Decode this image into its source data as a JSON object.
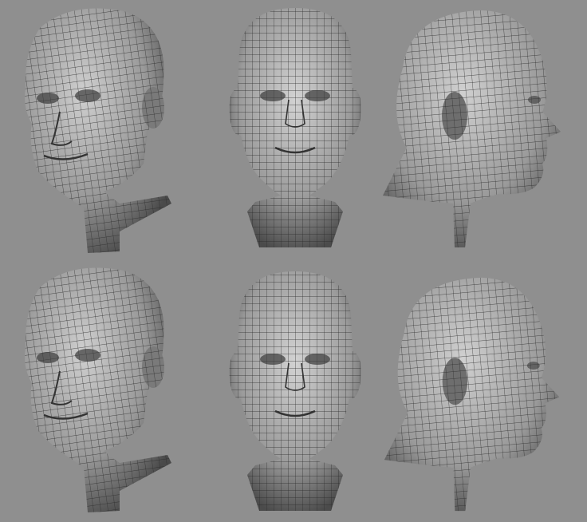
{
  "scene": {
    "background": "#8f8f8f",
    "mesh_fill": "#b8b8b8",
    "mesh_shade": "#5a5a5a",
    "wire_color": "#2a2a2a"
  },
  "renders": [
    {
      "id": "head-3q-left-top",
      "view": "three-quarter-left",
      "row": 1
    },
    {
      "id": "head-front-top",
      "view": "front",
      "row": 1
    },
    {
      "id": "head-profile-right-top",
      "view": "profile-right",
      "row": 1
    },
    {
      "id": "head-3q-left-bottom",
      "view": "three-quarter-left",
      "row": 2
    },
    {
      "id": "head-front-bottom",
      "view": "front",
      "row": 2
    },
    {
      "id": "head-profile-right-bottom",
      "view": "profile-right",
      "row": 2
    }
  ]
}
